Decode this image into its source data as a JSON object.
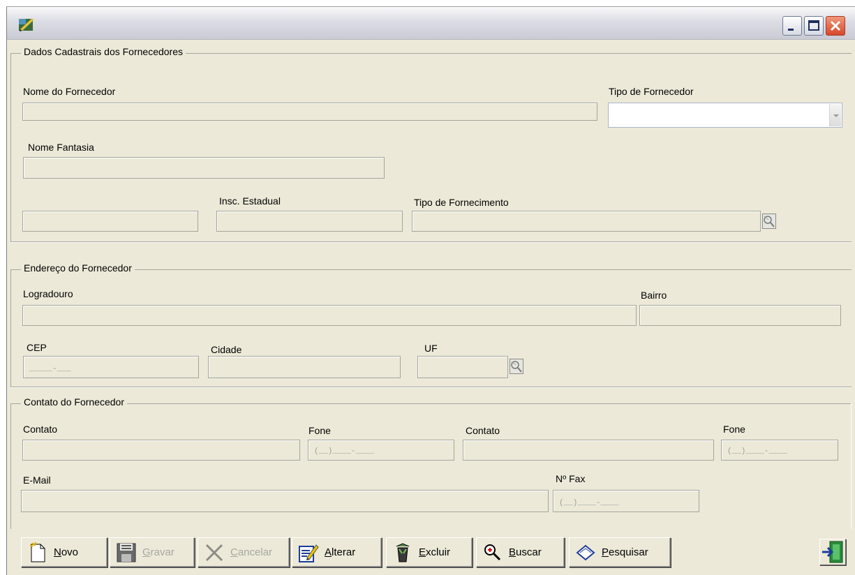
{
  "window": {
    "title": "",
    "controls": {
      "minimize": "minimize",
      "maximize": "maximize",
      "close": "close"
    }
  },
  "supplier_data": {
    "group_title": "Dados Cadastrais dos Fornecedores",
    "name_label": "Nome do Fornecedor",
    "name_value": "",
    "type_label": "Tipo de Fornecedor",
    "type_value": "",
    "trade_name_label": "Nome Fantasia",
    "trade_name_value": "",
    "unlabeled_doc_value": "",
    "state_reg_label": "Insc. Estadual",
    "state_reg_value": "",
    "supply_type_label": "Tipo de Fornecimento",
    "supply_type_value": ""
  },
  "address": {
    "group_title": "Endereço do Fornecedor",
    "street_label": "Logradouro",
    "street_value": "",
    "district_label": "Bairro",
    "district_value": "",
    "cep_label": "CEP",
    "cep_mask": "_____-___",
    "city_label": "Cidade",
    "city_value": "",
    "uf_label": "UF",
    "uf_value": ""
  },
  "contact": {
    "group_title": "Contato do Fornecedor",
    "contact1_label": "Contato",
    "contact1_value": "",
    "phone1_label": "Fone",
    "phone1_mask": "(__)____-____",
    "contact2_label": "Contato",
    "contact2_value": "",
    "phone2_label": "Fone",
    "phone2_mask": "(__)____-____",
    "email_label": "E-Mail",
    "email_value": "",
    "fax_label": "Nº Fax",
    "fax_mask": "(__)____-____"
  },
  "toolbar": {
    "new_label": "Novo",
    "save_label": "Gravar",
    "cancel_label": "Cancelar",
    "edit_label": "Alterar",
    "delete_label": "Excluir",
    "find_label": "Buscar",
    "search_label": "Pesquisar"
  },
  "colors": {
    "window_bg": "#ece9d8",
    "field_border": "#a5a59d",
    "close_button": "#d8462b",
    "disabled_text": "#a8a8a0"
  },
  "icons": [
    "app-icon",
    "minimize-icon",
    "maximize-icon",
    "close-icon",
    "lookup-icon",
    "new-document-icon",
    "floppy-disk-icon",
    "x-cancel-icon",
    "edit-pencil-icon",
    "trash-bin-icon",
    "magnifier-icon",
    "book-search-icon",
    "exit-door-icon"
  ]
}
